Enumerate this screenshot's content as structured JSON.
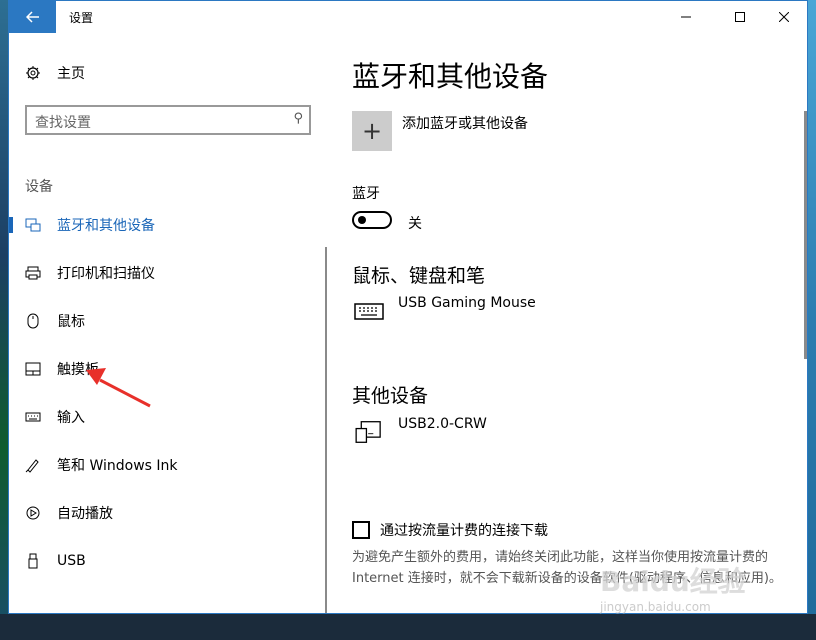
{
  "window": {
    "title": "设置",
    "back_icon": "arrow-left-icon",
    "minimize_icon": "minimize-icon",
    "maximize_icon": "maximize-icon",
    "close_icon": "close-icon"
  },
  "sidebar": {
    "home_label": "主页",
    "search_placeholder": "查找设置",
    "section_title": "设备",
    "items": [
      {
        "label": "蓝牙和其他设备",
        "icon": "bluetooth-devices-icon",
        "active": true
      },
      {
        "label": "打印机和扫描仪",
        "icon": "printer-icon"
      },
      {
        "label": "鼠标",
        "icon": "mouse-icon"
      },
      {
        "label": "触摸板",
        "icon": "touchpad-icon"
      },
      {
        "label": "输入",
        "icon": "keyboard-icon"
      },
      {
        "label": "笔和 Windows Ink",
        "icon": "pen-icon"
      },
      {
        "label": "自动播放",
        "icon": "autoplay-icon"
      },
      {
        "label": "USB",
        "icon": "usb-icon"
      }
    ]
  },
  "main": {
    "title": "蓝牙和其他设备",
    "add_device_label": "添加蓝牙或其他设备",
    "bluetooth_label": "蓝牙",
    "bluetooth_state": "关",
    "mouse_section_title": "鼠标、键盘和笔",
    "mouse_device": "USB Gaming Mouse",
    "other_section_title": "其他设备",
    "other_device": "USB2.0-CRW",
    "metered_label": "通过按流量计费的连接下载",
    "metered_desc": "为避免产生额外的费用，请始终关闭此功能，这样当你使用按流量计费的 Internet 连接时，就不会下载新设备的设备软件(驱动程序、信息和应用)。"
  },
  "annotation": {
    "arrow_color": "#e8302a"
  },
  "watermark": {
    "text1": "Baidu经验",
    "text2": "jingyan.baidu.com"
  }
}
